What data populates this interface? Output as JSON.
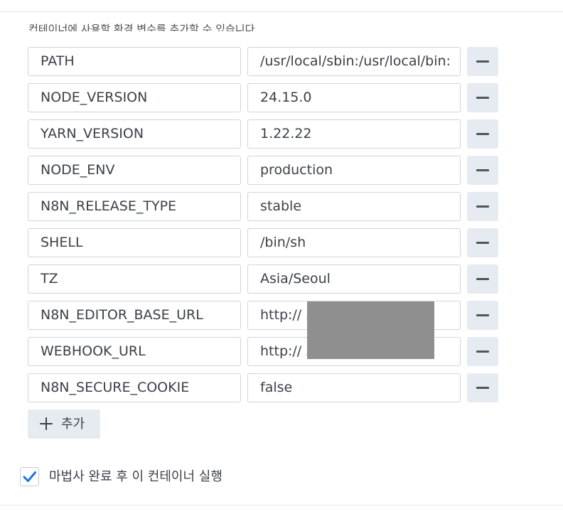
{
  "description": "컨테이너에 사용할 환경 변수를 추가할 수 있습니다.",
  "env_vars": [
    {
      "key": "PATH",
      "value": "/usr/local/sbin:/usr/local/bin:/usr/sbin:/usr/bin:/sbin:/bin"
    },
    {
      "key": "NODE_VERSION",
      "value": "24.15.0"
    },
    {
      "key": "YARN_VERSION",
      "value": "1.22.22"
    },
    {
      "key": "NODE_ENV",
      "value": "production"
    },
    {
      "key": "N8N_RELEASE_TYPE",
      "value": "stable"
    },
    {
      "key": "SHELL",
      "value": "/bin/sh"
    },
    {
      "key": "TZ",
      "value": "Asia/Seoul"
    },
    {
      "key": "N8N_EDITOR_BASE_URL",
      "value": "http://                        56"
    },
    {
      "key": "WEBHOOK_URL",
      "value": "http://                        56"
    },
    {
      "key": "N8N_SECURE_COOKIE",
      "value": "false"
    }
  ],
  "add_button": {
    "label": "추가",
    "icon": "plus-icon"
  },
  "remove_button": {
    "icon": "minus-icon"
  },
  "run_after_wizard": {
    "label": "마법사 완료 후 이 컨테이너 실행",
    "checked": true
  },
  "colors": {
    "accent": "#1a73e8",
    "button_bg": "#e6ebf1",
    "border": "#cfd4db",
    "text": "#3b4049"
  }
}
